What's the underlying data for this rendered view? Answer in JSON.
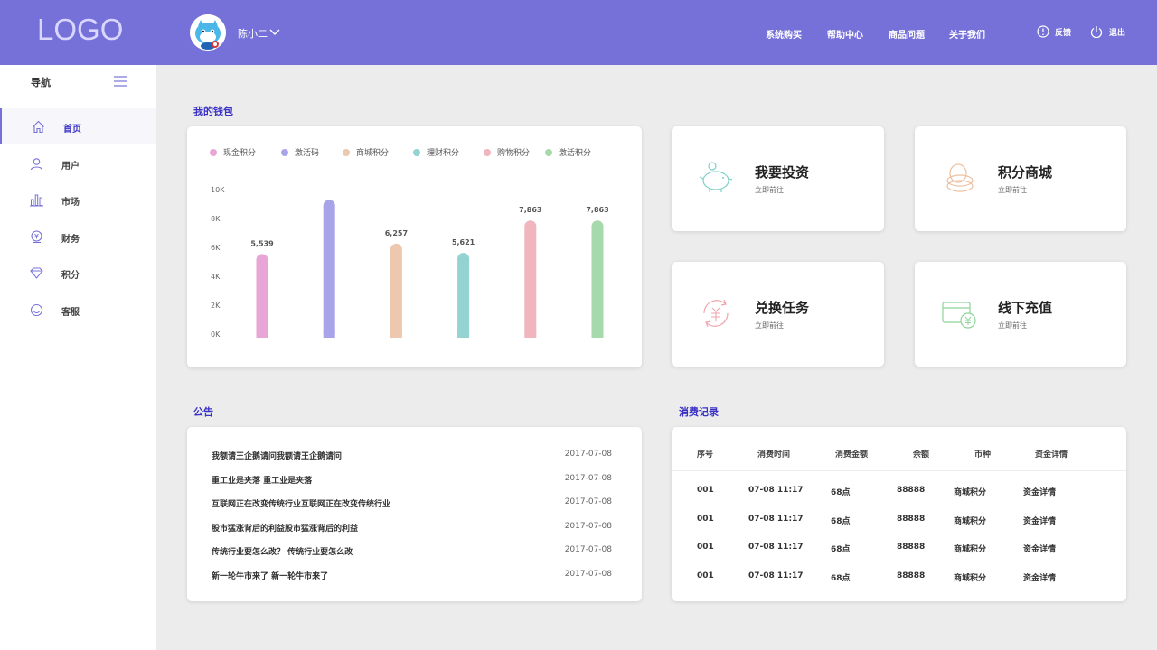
{
  "header": {
    "logo": "LOGO",
    "username": "陈小二",
    "nav": [
      "系统购买",
      "帮助中心",
      "商品问题",
      "关于我们"
    ],
    "feedback": "反馈",
    "logout": "退出"
  },
  "sidebar": {
    "title": "导航",
    "items": [
      {
        "label": "首页",
        "icon": "home-icon"
      },
      {
        "label": "用户",
        "icon": "user-icon"
      },
      {
        "label": "市场",
        "icon": "bar-chart-icon"
      },
      {
        "label": "财务",
        "icon": "finance-icon"
      },
      {
        "label": "积分",
        "icon": "diamond-icon"
      },
      {
        "label": "客服",
        "icon": "smile-icon"
      }
    ]
  },
  "wallet": {
    "title": "我的钱包",
    "legend": [
      "现金积分",
      "激活码",
      "商城积分",
      "理财积分",
      "购物积分",
      "激活积分"
    ]
  },
  "chart_data": {
    "type": "bar",
    "categories": [
      "现金积分",
      "激活码",
      "商城积分",
      "理财积分",
      "购物积分",
      "激活积分"
    ],
    "values": [
      5539,
      9300,
      6257,
      5621,
      7863,
      7863
    ],
    "data_labels": [
      "5,539",
      "",
      "6,257",
      "5,621",
      "7,863",
      "7,863"
    ],
    "colors": [
      "#e7a6d6",
      "#a9a4ea",
      "#ecc8ae",
      "#93d3d1",
      "#f0b5bd",
      "#a6d9ab"
    ],
    "yticks": [
      "10K",
      "8K",
      "6K",
      "4K",
      "2K",
      "0K"
    ],
    "ylim": [
      0,
      10000
    ]
  },
  "quick": [
    {
      "title": "我要投资",
      "sub": "立即前往",
      "icon": "piggy-bank-icon"
    },
    {
      "title": "积分商城",
      "sub": "立即前往",
      "icon": "coins-icon"
    },
    {
      "title": "兑换任务",
      "sub": "立即前往",
      "icon": "exchange-icon"
    },
    {
      "title": "线下充值",
      "sub": "立即前往",
      "icon": "card-recharge-icon"
    }
  ],
  "notice": {
    "title": "公告",
    "items": [
      {
        "text": "我额请王企鹅请问我额请王企鹅请问",
        "date": "2017-07-08"
      },
      {
        "text": "重工业是夹落 重工业是夹落",
        "date": "2017-07-08"
      },
      {
        "text": "互联网正在改变传统行业互联网正在改变传统行业",
        "date": "2017-07-08"
      },
      {
        "text": "股市猛涨背后的利益股市猛涨背后的利益",
        "date": "2017-07-08"
      },
      {
        "text": "传统行业要怎么改？ 传统行业要怎么改",
        "date": "2017-07-08"
      },
      {
        "text": "新一轮牛市来了 新一轮牛市来了",
        "date": "2017-07-08"
      }
    ]
  },
  "records": {
    "title": "消费记录",
    "columns": [
      "序号",
      "消费时间",
      "消费金额",
      "余额",
      "币种",
      "资金详情"
    ],
    "rows": [
      [
        "001",
        "07-08  11:17",
        "68点",
        "88888",
        "商城积分",
        "资金详情"
      ],
      [
        "001",
        "07-08  11:17",
        "68点",
        "88888",
        "商城积分",
        "资金详情"
      ],
      [
        "001",
        "07-08  11:17",
        "68点",
        "88888",
        "商城积分",
        "资金详情"
      ],
      [
        "001",
        "07-08  11:17",
        "68点",
        "88888",
        "商城积分",
        "资金详情"
      ]
    ]
  }
}
